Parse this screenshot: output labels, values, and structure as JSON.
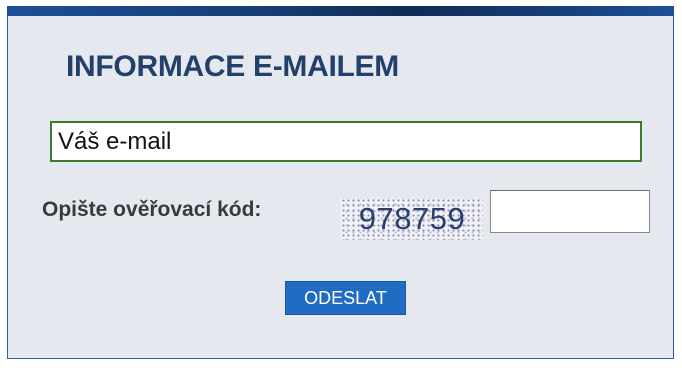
{
  "form": {
    "title": "INFORMACE E-MAILEM",
    "email_value": "Váš e-mail",
    "captcha_label": "Opište ověřovací kód:",
    "captcha_code": "978759",
    "captcha_input_value": "",
    "submit_label": "ODESLAT"
  },
  "colors": {
    "panel_background": "#e6e8f0",
    "panel_border": "#2b62a8",
    "title": "#23406a",
    "email_border": "#3d7a2e",
    "button_background": "#1f6cc2",
    "button_text": "#ffffff"
  }
}
